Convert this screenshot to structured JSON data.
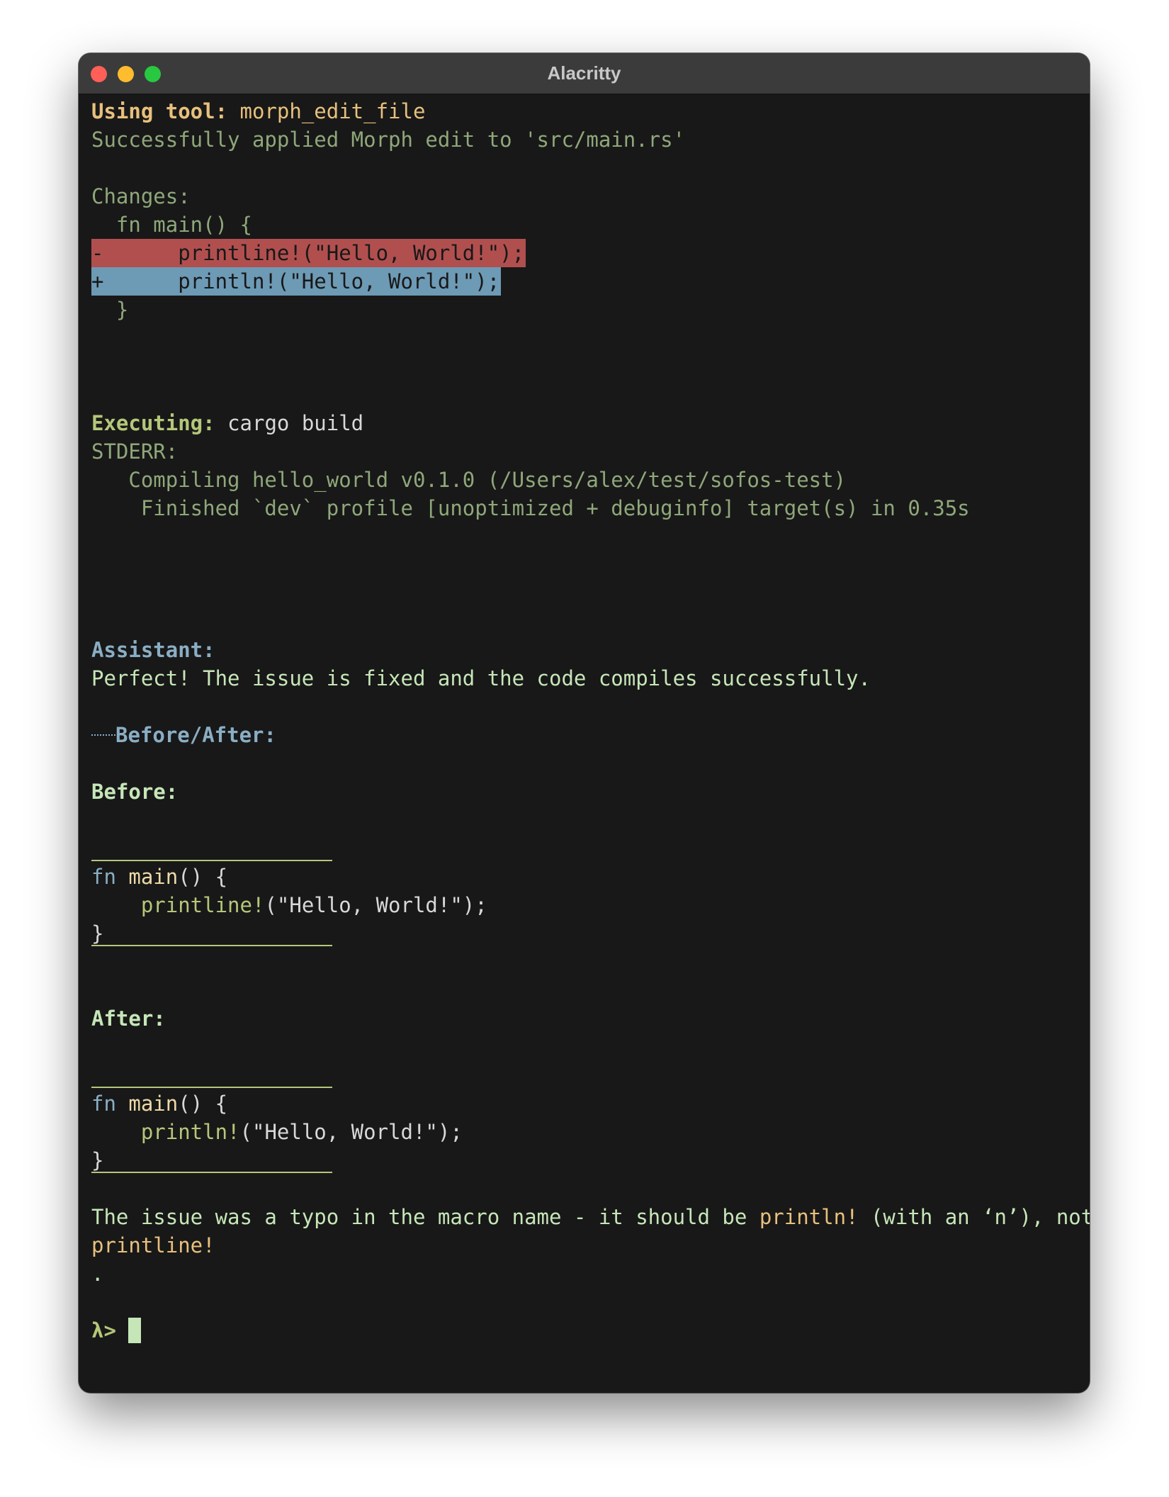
{
  "window": {
    "title": "Alacritty"
  },
  "tool": {
    "label": "Using tool:",
    "name": "morph_edit_file",
    "result": "Successfully applied Morph edit to 'src/main.rs'"
  },
  "changes": {
    "label": "Changes:",
    "line_fn": "  fn main() {",
    "removed": "-      printline!(\"Hello, World!\");",
    "added": "+      println!(\"Hello, World!\");",
    "close": "  }"
  },
  "exec": {
    "label": "Executing:",
    "command": "cargo build",
    "stderr_label": "STDERR:",
    "stderr_lines": [
      "   Compiling hello_world v0.1.0 (/Users/alex/test/sofos-test)",
      "    Finished `dev` profile [unoptimized + debuginfo] target(s) in 0.35s"
    ]
  },
  "assistant": {
    "label": "Assistant:",
    "message": "Perfect! The issue is fixed and the code compiles successfully.",
    "section_heading": "Before/After:",
    "before_label": "Before:",
    "after_label": "After:",
    "before_code": {
      "fn_kw": "fn",
      "fn_name": "main",
      "fn_rest": "() {",
      "indent": "    ",
      "macro": "printline!",
      "args": "(\"Hello, World!\");",
      "close": "}"
    },
    "after_code": {
      "fn_kw": "fn",
      "fn_name": "main",
      "fn_rest": "() {",
      "indent": "    ",
      "macro": "println!",
      "args": "(\"Hello, World!\");",
      "close": "}"
    },
    "explanation": {
      "part1": "The issue was a typo in the macro name - it should be ",
      "correct": "println!",
      "part2": " (with an ‘n’), not",
      "wrong": "printline!",
      "dot": "."
    }
  },
  "prompt": {
    "symbol": "λ>"
  }
}
